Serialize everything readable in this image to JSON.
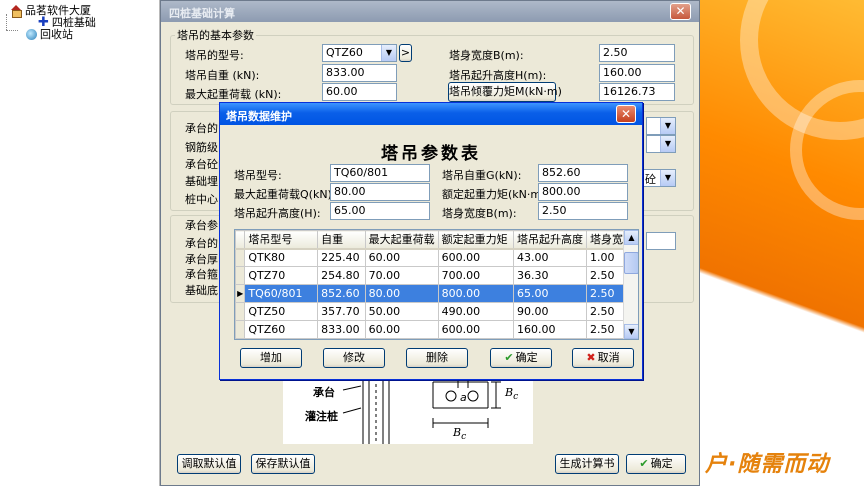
{
  "tree": {
    "root_label": "品茗软件大厦",
    "child_label": "四桩基础",
    "recycle_label": "回收站"
  },
  "main_window": {
    "title": "四桩基础计算",
    "close_glyph": "✕",
    "crane_group": {
      "legend": "塔吊的基本参数",
      "model_label": "塔吊的型号:",
      "model_value": "QTZ60",
      "more_glyph": ">",
      "self_weight_label": "塔吊自重 (kN):",
      "self_weight_value": "833.00",
      "max_load_label": "最大起重荷载 (kN):",
      "max_load_value": "60.00",
      "width_label": "塔身宽度B(m):",
      "width_value": "2.50",
      "height_label": "塔吊起升高度H(m):",
      "height_value": "160.00",
      "moment_button": "塔吊倾覆力矩M(kN·m)",
      "moment_value": "16126.73"
    },
    "cap_group_labels": [
      "承台的",
      "钢筋级",
      "承台砼的",
      "基础埋",
      "桩中心"
    ],
    "cap_combo_tail": "砼",
    "cap2_legend": "承台参",
    "cap2_labels": [
      "承台的",
      "承台厚",
      "承台箍",
      "基础底"
    ],
    "diagram": {
      "label_cap": "承台",
      "label_pile": "灌注桩",
      "label_a": "a",
      "label_bc": "B",
      "label_bc_sub": "c"
    },
    "buttons": {
      "read_default": "调取默认值",
      "save_default": "保存默认值",
      "generate": "生成计算书",
      "ok": "确定",
      "ok_icon": "✔"
    }
  },
  "modal": {
    "title": "塔吊数据维护",
    "close_glyph": "✕",
    "heading": "塔吊参数表",
    "fields": {
      "model_label": "塔吊型号:",
      "model_value": "TQ60/801",
      "weight_label": "塔吊自重G(kN):",
      "weight_value": "852.60",
      "maxload_label": "最大起重荷载Q(kN):",
      "maxload_value": "80.00",
      "moment_label": "额定起重力矩(kN·m):",
      "moment_value": "800.00",
      "height_label": "塔吊起升高度(H):",
      "height_value": "65.00",
      "width_label": "塔身宽度B(m):",
      "width_value": "2.50"
    },
    "grid": {
      "columns": [
        "塔吊型号",
        "自重",
        "最大起重荷载",
        "额定起重力矩",
        "塔吊起升高度",
        "塔身宽度"
      ],
      "rows": [
        [
          "QTK80",
          "225.40",
          "60.00",
          "600.00",
          "43.00",
          "1.00"
        ],
        [
          "QTZ70",
          "254.80",
          "70.00",
          "700.00",
          "36.30",
          "2.50"
        ],
        [
          "TQ60/801",
          "852.60",
          "80.00",
          "800.00",
          "65.00",
          "2.50"
        ],
        [
          "QTZ50",
          "357.70",
          "50.00",
          "490.00",
          "90.00",
          "2.50"
        ],
        [
          "QTZ60",
          "833.00",
          "60.00",
          "600.00",
          "160.00",
          "2.50"
        ]
      ],
      "selected_row_index": 2,
      "current_marker": "▶",
      "scroll_up": "▲",
      "scroll_down": "▼"
    },
    "buttons": {
      "add": "增加",
      "edit": "修改",
      "delete": "删除",
      "ok": "确定",
      "ok_icon": "✔",
      "cancel": "取消",
      "cancel_icon": "✖"
    }
  },
  "background": {
    "slogan": "户·随需而动"
  }
}
